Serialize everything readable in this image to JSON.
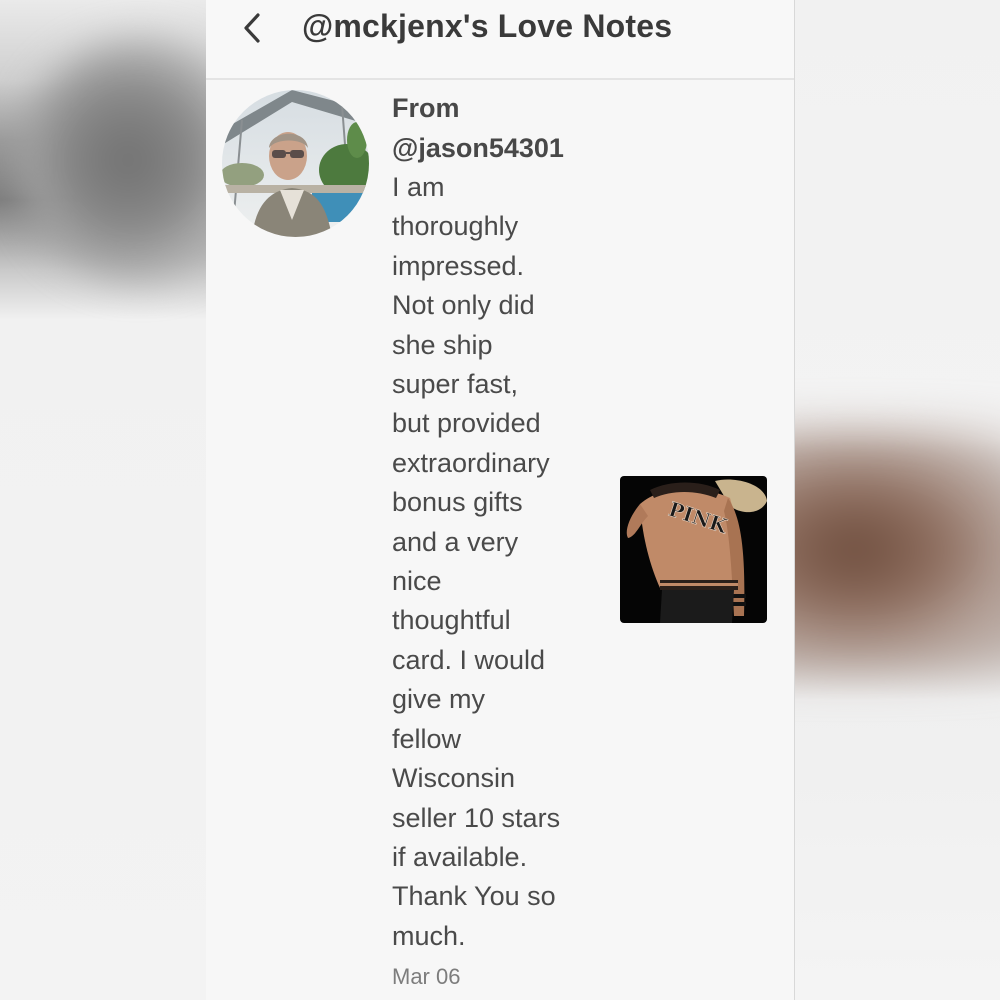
{
  "header": {
    "title": "@mckjenx's Love Notes",
    "back_icon": "chevron-left-icon"
  },
  "note": {
    "from_label": "From",
    "username": "@jason54301",
    "lines": [
      "I am",
      "thoroughly",
      "impressed.",
      "Not only did",
      "she ship",
      "super fast,",
      "but provided",
      "extraordinary",
      "bonus gifts",
      "and a very",
      "nice",
      "thoughtful",
      "card. I would",
      "give my",
      "fellow",
      "Wisconsin",
      "seller 10 stars",
      "if available.",
      "Thank You so",
      "much."
    ],
    "date": "Mar 06",
    "product_thumb_text": "PINK"
  },
  "colors": {
    "text": "#4a4a4a",
    "date": "#7d7d7d",
    "background": "#f7f7f7"
  }
}
